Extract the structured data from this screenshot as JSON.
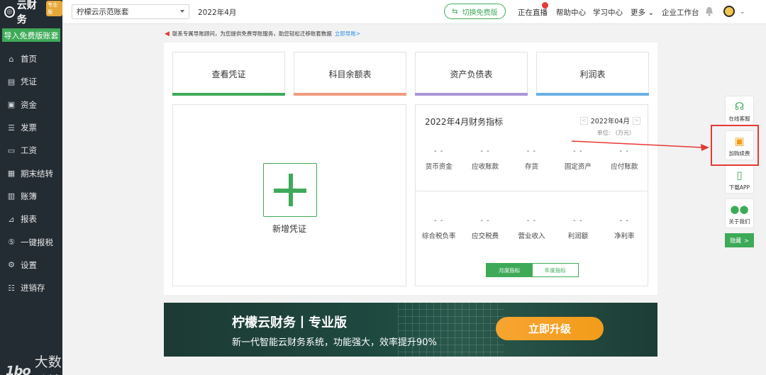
{
  "sidebar": {
    "logo_text": "云财务",
    "logo_badge": "专业版",
    "import_button": "导入免费版账套",
    "items": [
      {
        "label": "首页",
        "icon": "home-icon",
        "glyph": "⌂"
      },
      {
        "label": "凭证",
        "icon": "voucher-icon",
        "glyph": "▤"
      },
      {
        "label": "资金",
        "icon": "fund-icon",
        "glyph": "▣"
      },
      {
        "label": "发票",
        "icon": "invoice-icon",
        "glyph": "☰"
      },
      {
        "label": "工资",
        "icon": "salary-icon",
        "glyph": "▭"
      },
      {
        "label": "期末结转",
        "icon": "period-end-icon",
        "glyph": "▦"
      },
      {
        "label": "账簿",
        "icon": "ledger-icon",
        "glyph": "▥"
      },
      {
        "label": "报表",
        "icon": "report-icon",
        "glyph": "⊿"
      },
      {
        "label": "一键报税",
        "icon": "tax-icon",
        "glyph": "⑤"
      },
      {
        "label": "设置",
        "icon": "settings-icon",
        "glyph": "⚙"
      },
      {
        "label": "进销存",
        "icon": "inventory-icon",
        "glyph": "☷"
      }
    ]
  },
  "header": {
    "account": "柠檬云示范账套",
    "period": "2022年4月",
    "switch_label": "切换免费版",
    "links": {
      "live": "正在直播",
      "help": "帮助中心",
      "learn": "学习中心",
      "more": "更多",
      "workbench": "企业工作台"
    }
  },
  "notice": {
    "text": "联系专属导账顾问，为您提供免费导账服务，助您轻松迁移账套数据",
    "link": "立即导账>"
  },
  "quick_cards": [
    {
      "label": "查看凭证",
      "color": "#3eaa58"
    },
    {
      "label": "科目余额表",
      "color": "#f19a7e"
    },
    {
      "label": "资产负债表",
      "color": "#a996d6"
    },
    {
      "label": "利润表",
      "color": "#6cb0e6"
    }
  ],
  "new_voucher": {
    "label": "新增凭证"
  },
  "metrics": {
    "title": "2022年4月财务指标",
    "period": "2022年04月",
    "unit": "单位: （万元）",
    "row1": [
      {
        "value": "- -",
        "label": "货币资金"
      },
      {
        "value": "- -",
        "label": "应收账款"
      },
      {
        "value": "- -",
        "label": "存货"
      },
      {
        "value": "- -",
        "label": "固定资产"
      },
      {
        "value": "- -",
        "label": "应付账款"
      }
    ],
    "row2": [
      {
        "value": "- -",
        "label": "综合税负率"
      },
      {
        "value": "- -",
        "label": "应交税费"
      },
      {
        "value": "- -",
        "label": "营业收入"
      },
      {
        "value": "- -",
        "label": "利润额"
      },
      {
        "value": "- -",
        "label": "净利率"
      }
    ],
    "toggle": {
      "monthly": "月度指标",
      "yearly": "年度指标"
    }
  },
  "banner": {
    "title": "柠檬云财务丨专业版",
    "subtitle": "新一代智能云财务系统，功能强大，效率提升90%",
    "button": "立即升级"
  },
  "float_bar": {
    "service": "在线客服",
    "renew": "加购续费",
    "app": "下载APP",
    "about": "关于我们",
    "hide": "隐藏"
  },
  "watermark": {
    "logo": "1bo",
    "text": "大数跨境"
  },
  "colors": {
    "brand": "#3eaa58",
    "sidebar": "#232b33",
    "alert": "#e53935"
  }
}
